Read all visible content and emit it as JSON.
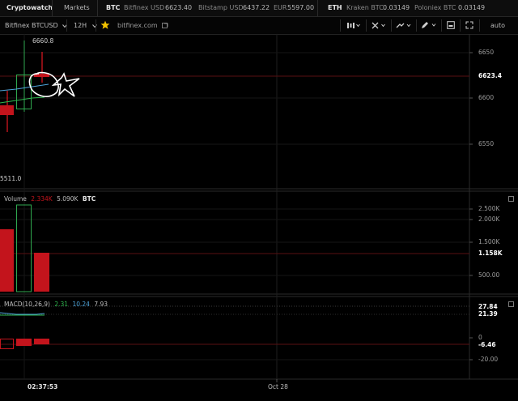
{
  "topbar": {
    "brand": "Cryptowatch",
    "markets": "Markets",
    "btc": {
      "label": "BTC",
      "bitfinex": "Bitfinex USD",
      "bitfinex_price": "6623.40",
      "bitstamp": "Bitstamp USD",
      "bitstamp_price": "6437.22",
      "eur": "EUR",
      "eur_price": "5597.00"
    },
    "eth": {
      "label": "ETH",
      "kraken": "Kraken BTC",
      "kraken_price": "0.03149",
      "poloniex": "Poloniex BTC",
      "poloniex_price": "0.03149"
    }
  },
  "toolbar": {
    "market_select": "Bitfinex BTCUSD",
    "period_select": "12H",
    "star_icon": "star-icon",
    "domain": "bitfinex.com",
    "icons": [
      "chart-type-icon",
      "indicators-icon",
      "drawing-tools-icon",
      "pen-icon",
      "save-icon",
      "fullscreen-icon"
    ],
    "auto_label": "auto"
  },
  "price_panel": {
    "high_label": "6660.8",
    "low_label": "5511.0",
    "axis": [
      "6650",
      "6623.4",
      "6600",
      "6550"
    ],
    "current": "6623.4"
  },
  "volume_panel": {
    "title": "Volume",
    "value1": "2.334K",
    "value2": "5.090K",
    "unit": "BTC",
    "axis": [
      "2.500K",
      "2.000K",
      "1.500K",
      "1.158K",
      "500.00"
    ],
    "current": "1.158K"
  },
  "macd_panel": {
    "title": "MACD(10,26,9)",
    "v1": "2.31",
    "v2": "10.24",
    "v3": "7.93",
    "axis": [
      "27.84",
      "21.39",
      "0",
      "-6.46",
      "-20.00"
    ]
  },
  "time_axis": {
    "cursor_time": "02:37:53",
    "label": "Oct 28"
  },
  "colors": {
    "up": "#2fa84f",
    "down": "#c3141c",
    "accent_star": "#f2c200",
    "macd_blue": "#4ea3d8",
    "macd_green": "#2fb84f"
  }
}
